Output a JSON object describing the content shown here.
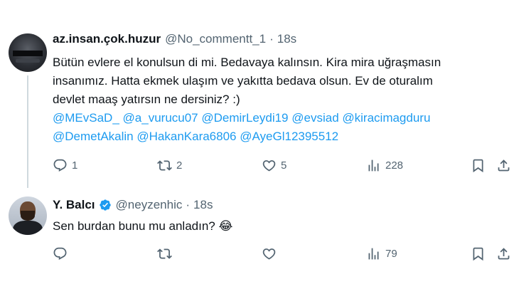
{
  "tweets": [
    {
      "name": "az.insan.çok.huzur",
      "handle": "@No_commentt_1",
      "dot": "·",
      "time": "18s",
      "text_lines": [
        "Bütün evlere el konulsun di mi. Bedavaya kalınsın. Kira mira uğraşmasın",
        "insanımız. Hatta ekmek ulaşım ve yakıtta bedava olsun. Ev de oturalım",
        "devlet maaş yatırsın ne dersiniz? :)"
      ],
      "mentions_line1": [
        "@MEvSaD_",
        "@a_vurucu07",
        "@DemirLeydi19",
        "@evsiad",
        "@kiracimagduru"
      ],
      "mentions_line2": [
        "@DemetAkalin",
        "@HakanKara6806",
        "@AyeGl12395512"
      ],
      "replies": "1",
      "retweets": "2",
      "likes": "5",
      "views": "228"
    },
    {
      "name": "Y. Balcı",
      "handle": "@neyzenhic",
      "dot": "·",
      "time": "18s",
      "verified": true,
      "text": "Sen burdan bunu mu anladın? 😂",
      "views": "79"
    }
  ],
  "icons": {
    "reply": "reply-icon",
    "retweet": "retweet-icon",
    "like": "heart-icon",
    "views": "views-icon",
    "bookmark": "bookmark-icon",
    "share": "share-icon",
    "verified": "verified-badge-icon"
  },
  "colors": {
    "link": "#1d9bf0",
    "secondary_text": "#536471",
    "primary_text": "#0f1419",
    "thread_line": "#cfd9de"
  }
}
